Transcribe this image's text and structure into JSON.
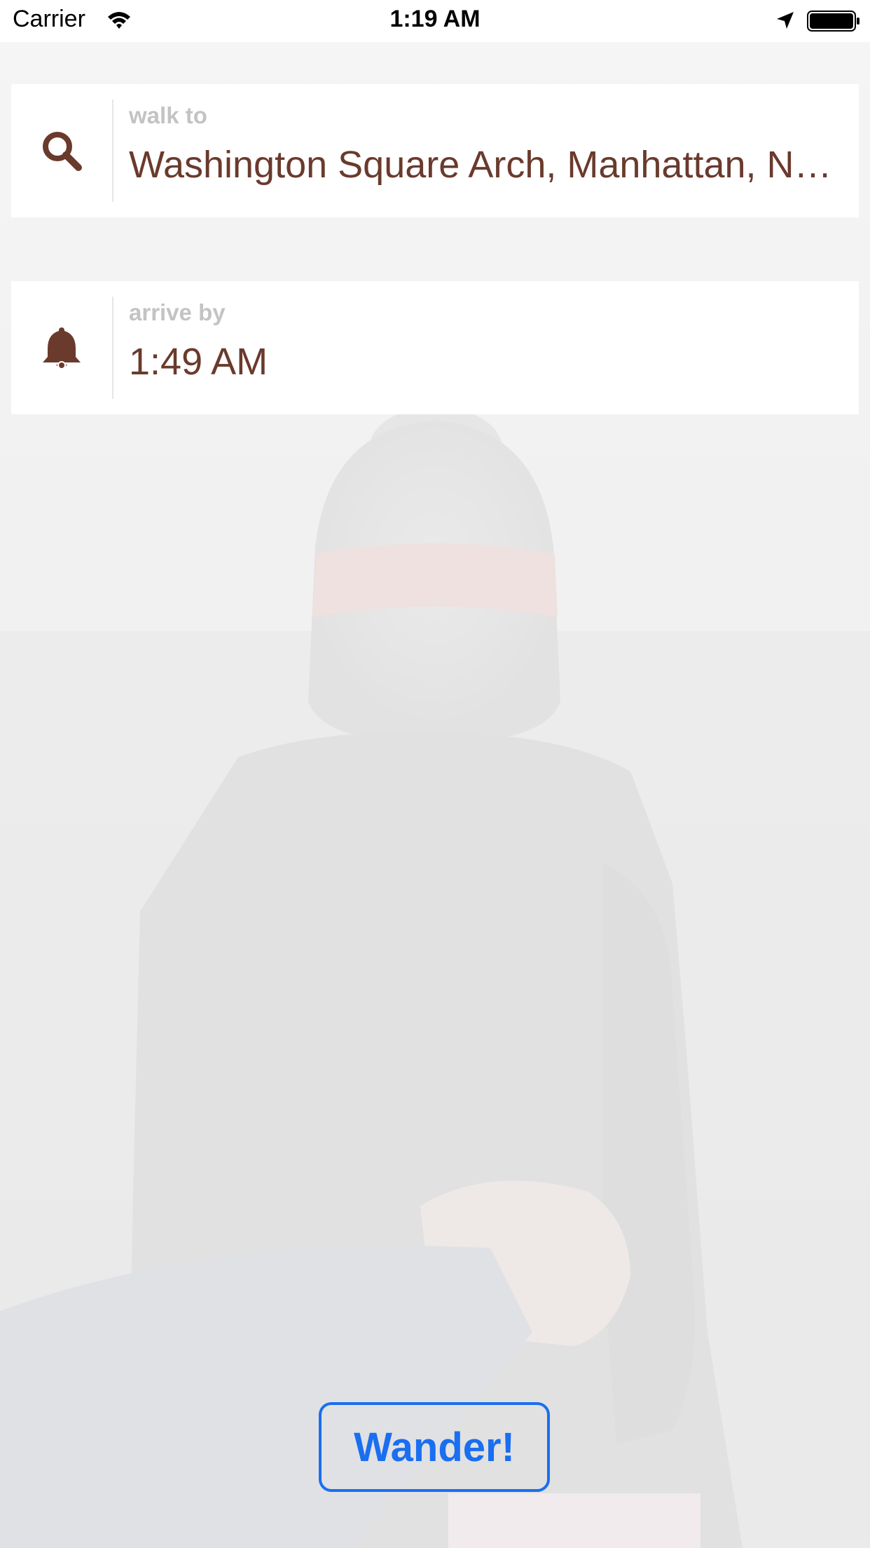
{
  "status_bar": {
    "carrier": "Carrier",
    "time": "1:19 AM",
    "icons": [
      "wifi-icon",
      "location-arrow-icon",
      "battery-icon"
    ]
  },
  "destination": {
    "label": "walk to",
    "value": "Washington Square Arch, Manhattan, N…",
    "icon": "search-icon"
  },
  "arrival": {
    "label": "arrive by",
    "value": "1:49 AM",
    "icon": "bell-icon"
  },
  "action": {
    "button_label": "Wander!"
  },
  "colors": {
    "accent_brown": "#6a3a2c",
    "button_blue": "#1a6ef0",
    "label_gray": "#c3c3c3"
  }
}
